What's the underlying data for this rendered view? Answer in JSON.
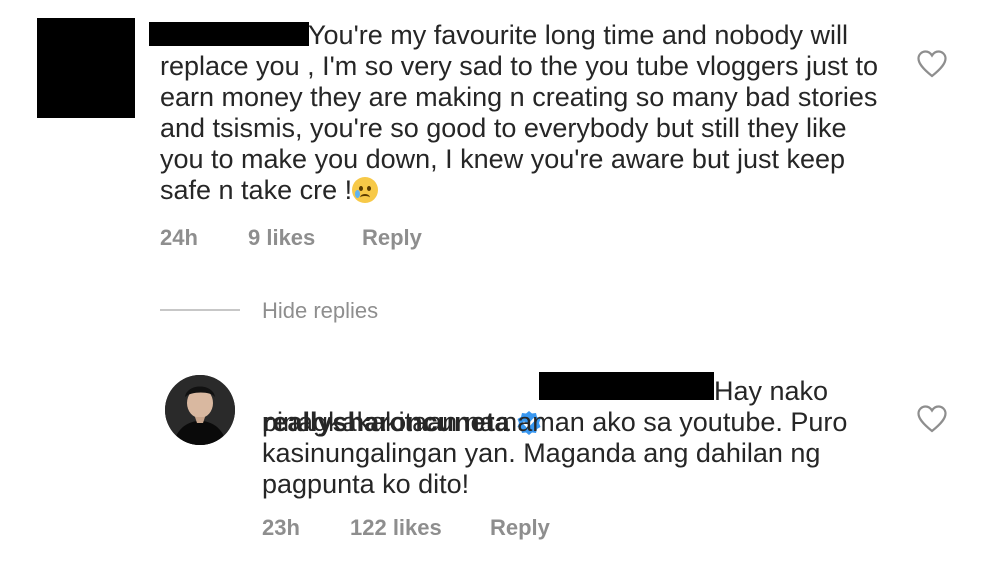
{
  "comment": {
    "text_line1": "You're my favourite long time and nobody will",
    "text_rest": "replace you , I'm so very sad to the you tube vloggers just to\nearn money  they are making n creating so many bad stories\nand tsismis, you're so good to everybody but still they like\nyou to make you down, I knew you're aware but just keep\nsafe n take cre !",
    "emoji": "crying-face",
    "time": "24h",
    "likes": "9 likes",
    "reply_label": "Reply"
  },
  "hide_replies_label": "Hide replies",
  "reply": {
    "username": "reallysharoncuneta",
    "verified": true,
    "text_line1": "Hay nako",
    "text_rest": "pinagkakakitaan na naman ako sa youtube. Puro\nkasinungalingan yan. Maganda ang dahilan ng\npagpunta ko dito!",
    "time": "23h",
    "likes": "122 likes",
    "reply_label": "Reply"
  },
  "colors": {
    "text": "#262626",
    "meta": "#8e8e8e",
    "verified": "#3897f0",
    "redaction": "#000000"
  },
  "icons": [
    "heart-outline-icon",
    "verified-badge-icon",
    "crying-face-emoji"
  ]
}
